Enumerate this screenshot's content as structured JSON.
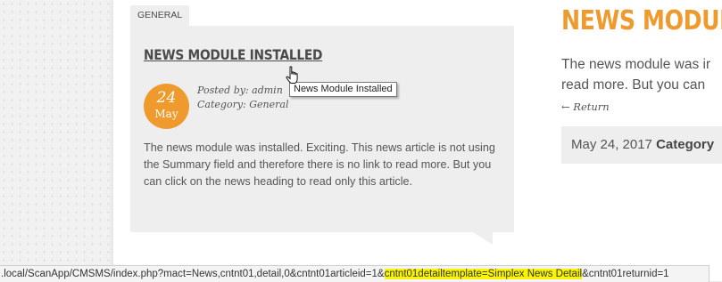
{
  "article": {
    "category_tab": "GENERAL",
    "title": "NEWS MODULE INSTALLED",
    "date_day": "24",
    "date_month": "May",
    "posted_by": "Posted by: admin",
    "category": "Category: General",
    "body": "The news module was installed. Exciting. This news article is not using the Summary field and therefore there is no link to read more. But you can click on the news heading to read only this article."
  },
  "tooltip": "News Module Installed",
  "detail": {
    "title": "NEWS MODULI",
    "text_line1": "The news module was ir",
    "text_line2": "read more. But you can",
    "return_link": "← Return",
    "date": "May 24, 2017",
    "category_label": "Category"
  },
  "status": {
    "url_prefix": ".local/ScanApp/CMSMS/index.php?mact=News,cntnt01,detail,0&cntnt01articleid=1&",
    "url_highlight": "cntnt01detailtemplate=Simplex News Detail",
    "url_suffix": "&cntnt01returnid=1"
  },
  "colors": {
    "accent": "#ef9a2c",
    "highlight": "#fbf400"
  }
}
